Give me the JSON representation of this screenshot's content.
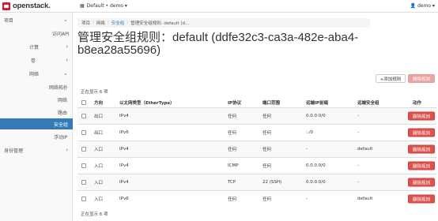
{
  "topbar": {
    "logo_text": "openstack.",
    "project_label": "Default • demo ▾",
    "user_label": "demo ▾"
  },
  "sidebar": {
    "items": [
      {
        "label": "项目",
        "chevron": "⌄"
      },
      {
        "label": "访问API",
        "chevron": ""
      },
      {
        "label": "计算",
        "chevron": "›"
      },
      {
        "label": "卷",
        "chevron": "›"
      },
      {
        "label": "网络",
        "chevron": "⌄"
      },
      {
        "label": "网络拓扑",
        "chevron": ""
      },
      {
        "label": "网络",
        "chevron": ""
      },
      {
        "label": "路由",
        "chevron": ""
      },
      {
        "label": "安全组",
        "chevron": ""
      },
      {
        "label": "浮动IP",
        "chevron": ""
      },
      {
        "label": "身份管理",
        "chevron": "›"
      }
    ]
  },
  "breadcrumb": {
    "items": [
      "项目",
      "网络",
      "安全组",
      "管理安全组规则: default (d..."
    ]
  },
  "page_title": "管理安全组规则：default (ddfe32c3-ca3a-482e-aba4-b8ea28a55696)",
  "actions": {
    "add_rule": "+添加规则",
    "delete_rules": "删除规则"
  },
  "count_top": "正在显示 6 项",
  "count_bottom": "正在显示 6 项",
  "table": {
    "headers": [
      "方向",
      "以太网类型（EtherType）",
      "IP协议",
      "端口范围",
      "远端IP前缀",
      "远端安全组",
      "动作"
    ],
    "rows": [
      {
        "direction": "出口",
        "ethertype": "IPv4",
        "protocol": "任何",
        "port": "任何",
        "prefix": "0.0.0.0/0",
        "group": "-",
        "action": "删除规则"
      },
      {
        "direction": "出口",
        "ethertype": "IPv6",
        "protocol": "任何",
        "port": "任何",
        "prefix": "::/0",
        "group": "-",
        "action": "删除规则"
      },
      {
        "direction": "入口",
        "ethertype": "IPv4",
        "protocol": "任何",
        "port": "任何",
        "prefix": "-",
        "group": "default",
        "action": "删除规则"
      },
      {
        "direction": "入口",
        "ethertype": "IPv4",
        "protocol": "ICMP",
        "port": "任何",
        "prefix": "0.0.0.0/0",
        "group": "-",
        "action": "删除规则"
      },
      {
        "direction": "入口",
        "ethertype": "IPv4",
        "protocol": "TCP",
        "port": "22 (SSH)",
        "prefix": "0.0.0.0/0",
        "group": "-",
        "action": "删除规则"
      },
      {
        "direction": "入口",
        "ethertype": "IPv6",
        "protocol": "任何",
        "port": "任何",
        "prefix": "-",
        "group": "default",
        "action": "删除规则"
      }
    ]
  },
  "colors": {
    "active_nav": "#337ab7",
    "danger": "#d9534f",
    "brand": "#da1a32"
  }
}
